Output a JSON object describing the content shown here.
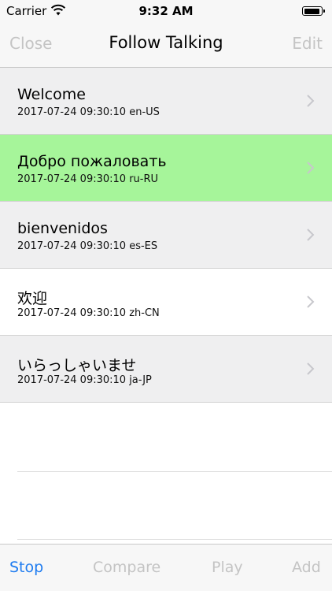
{
  "status_bar": {
    "carrier": "Carrier",
    "time": "9:32 AM",
    "wifi_icon": "wifi-icon",
    "battery_icon": "battery-icon"
  },
  "nav": {
    "left": "Close",
    "title": "Follow Talking",
    "right": "Edit"
  },
  "rows": [
    {
      "title": "Welcome",
      "subtitle": "2017-07-24 09:30:10 en-US",
      "bg": "#efeff0",
      "chevron_icon": "chevron-right-icon"
    },
    {
      "title": "Добро пожаловать",
      "subtitle": "2017-07-24 09:30:10 ru-RU",
      "bg": "#a6f59a",
      "chevron_icon": "chevron-right-icon"
    },
    {
      "title": "bienvenidos",
      "subtitle": "2017-07-24 09:30:10 es-ES",
      "bg": "#efeff0",
      "chevron_icon": "chevron-right-icon"
    },
    {
      "title": "欢迎",
      "subtitle": "2017-07-24 09:30:10 zh-CN",
      "bg": "#ffffff",
      "chevron_icon": "chevron-right-icon"
    },
    {
      "title": "いらっしゃいませ",
      "subtitle": "2017-07-24 09:30:10 ja-JP",
      "bg": "#efeff0",
      "chevron_icon": "chevron-right-icon"
    }
  ],
  "toolbar": {
    "stop": "Stop",
    "compare": "Compare",
    "play": "Play",
    "add": "Add"
  },
  "colors": {
    "accent": "#1f7cf0",
    "disabled": "#c4c4c4",
    "highlight_row": "#a6f59a",
    "alt_row": "#efeff0"
  }
}
